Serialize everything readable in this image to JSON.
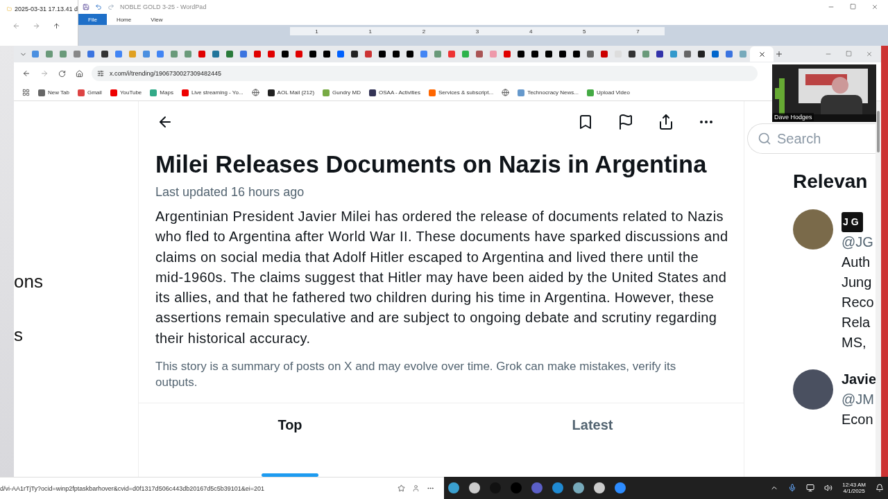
{
  "explorer": {
    "title": "2025-03-31 17.13.41 d"
  },
  "wordpad": {
    "title": "NOBLE GOLD 3-25 - WordPad",
    "ribbon_tabs": [
      {
        "label": "File",
        "selected": true
      },
      {
        "label": "Home",
        "selected": false
      },
      {
        "label": "View",
        "selected": false
      }
    ],
    "ruler_numbers": [
      "1",
      "1",
      "2",
      "3",
      "4",
      "5",
      "7"
    ]
  },
  "browser": {
    "address": "x.com/i/trending/1906730027309482445",
    "bookmarks": [
      {
        "kind": "link",
        "label": "New Tab"
      },
      {
        "kind": "link",
        "label": "Gmail"
      },
      {
        "kind": "link",
        "label": "YouTube"
      },
      {
        "kind": "link",
        "label": "Maps"
      },
      {
        "kind": "link",
        "label": "Live streaming - Yo..."
      },
      {
        "kind": "icon"
      },
      {
        "kind": "link",
        "label": "AOL Mail (212)"
      },
      {
        "kind": "link",
        "label": "Gundry MD"
      },
      {
        "kind": "link",
        "label": "OSAA - Activities"
      },
      {
        "kind": "link",
        "label": "Services & subscript..."
      },
      {
        "kind": "icon"
      },
      {
        "kind": "link",
        "label": "Technocracy News..."
      },
      {
        "kind": "link",
        "label": "Upload Video"
      }
    ]
  },
  "left_fragments": [
    "ons",
    "s"
  ],
  "article": {
    "title": "Milei Releases Documents on Nazis in Argentina",
    "updated": "Last updated 16 hours ago",
    "body": "Argentinian President Javier Milei has ordered the release of documents related to Nazis who fled to Argentina after World War II. These documents have sparked discussions and claims on social media that Adolf Hitler escaped to Argentina and lived there until the mid-1960s. The claims suggest that Hitler may have been aided by the United States and its allies, and that he fathered two children during his time in Argentina. However, these assertions remain speculative and are subject to ongoing debate and scrutiny regarding their historical accuracy.",
    "disclaimer": "This story is a summary of posts on X and may evolve over time. Grok can make mistakes, verify its outputs.",
    "tabs": [
      {
        "label": "Top",
        "selected": true
      },
      {
        "label": "Latest",
        "selected": false
      }
    ]
  },
  "sidebar": {
    "search_placeholder": "Search",
    "heading": "Relevan",
    "people": [
      {
        "name": "JG",
        "handle": "@JG",
        "bio": [
          "Auth",
          "Jung",
          "Reco",
          "Rela",
          "MS,"
        ]
      },
      {
        "name": "Javie",
        "handle": "@JM",
        "bio": [
          "Econ"
        ]
      }
    ]
  },
  "video": {
    "caption": "Dave Hodges"
  },
  "status_url": "d/vi-AA1rTjTy?ocid=winp2fptaskbarhover&cvid=d0f1317d506c443db20167d5c5b39101&ei=201",
  "taskbar": {
    "time": "12:43 AM",
    "date": "4/1/2025"
  }
}
